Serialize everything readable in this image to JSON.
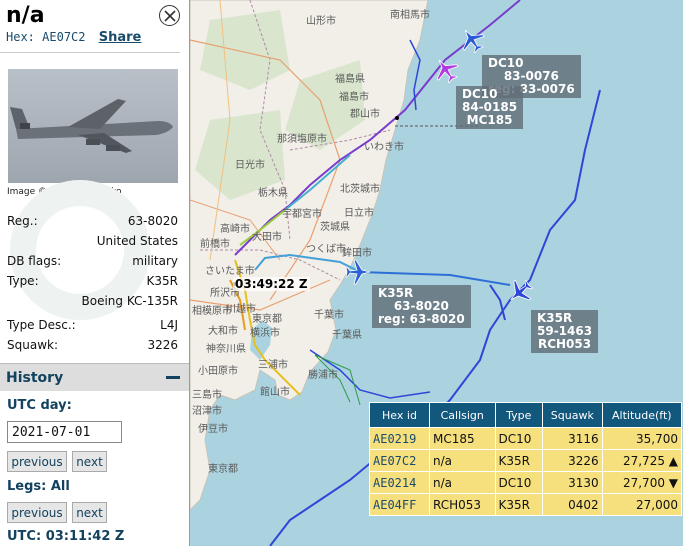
{
  "sidebar": {
    "title": "n/a",
    "hex_label": "Hex:",
    "hex": "AE07C2",
    "share": "Share",
    "image_credit": "Image © Andrei Shmatko",
    "fields": {
      "reg_key": "Reg.:",
      "reg_val": "63-8020",
      "country": "United States",
      "dbflags_key": "DB flags:",
      "dbflags_val": "military",
      "type_key": "Type:",
      "type_val": "K35R",
      "type_full": "Boeing KC-135R",
      "typedesc_key": "Type Desc.:",
      "typedesc_val": "L4J",
      "squawk_key": "Squawk:",
      "squawk_val": "3226"
    },
    "history": {
      "title": "History",
      "utc_day_label": "UTC day:",
      "date_value": "2021-07-01",
      "previous": "previous",
      "next": "next",
      "legs_label": "Legs: All",
      "utc_time": "UTC: 03:11:42 Z"
    }
  },
  "map": {
    "time_label": "03:49:22 Z",
    "aircraft_labels": [
      {
        "line1": "DC10",
        "line2": "83-0076",
        "line3": "reg: 83-0076"
      },
      {
        "line1": "DC10",
        "line2": "84-0185",
        "line3": "MC185"
      },
      {
        "line1": "K35R",
        "line2": "63-8020",
        "line3": "reg: 63-8020"
      },
      {
        "line1": "K35R",
        "line2": "59-1463",
        "line3": "RCH053"
      }
    ],
    "places": [
      "山形市",
      "福島県",
      "福島市",
      "郡山市",
      "那須塩原市",
      "日光市",
      "栃木県",
      "宇都宮市",
      "高崎市",
      "大田市",
      "つくば市",
      "前橋市",
      "北茨城市",
      "日立市",
      "茨城県",
      "鉾田市",
      "さいたま市",
      "所沢市",
      "川越市",
      "東京都",
      "千葉市",
      "千葉県",
      "大和市",
      "横浜市",
      "神奈川県",
      "三浦市",
      "勝浦市",
      "館山市",
      "小田原市",
      "伊豆市",
      "東京都",
      "いわき市",
      "南相馬市",
      "三島市",
      "沼津市",
      "相模原市"
    ],
    "colors": {
      "water": "#aad3df",
      "land": "#f2efe9"
    }
  },
  "table": {
    "headers": [
      "Hex id",
      "Callsign",
      "Type",
      "Squawk",
      "Altitude(ft)"
    ],
    "rows": [
      {
        "hex": "AE0219",
        "callsign": "MC185",
        "type": "DC10",
        "squawk": "3116",
        "altitude": "35,700"
      },
      {
        "hex": "AE07C2",
        "callsign": "n/a",
        "type": "K35R",
        "squawk": "3226",
        "altitude": "27,725 ▲"
      },
      {
        "hex": "AE0214",
        "callsign": "n/a",
        "type": "DC10",
        "squawk": "3130",
        "altitude": "27,700 ▼"
      },
      {
        "hex": "AE04FF",
        "callsign": "RCH053",
        "type": "K35R",
        "squawk": "0402",
        "altitude": "27,000"
      }
    ]
  }
}
